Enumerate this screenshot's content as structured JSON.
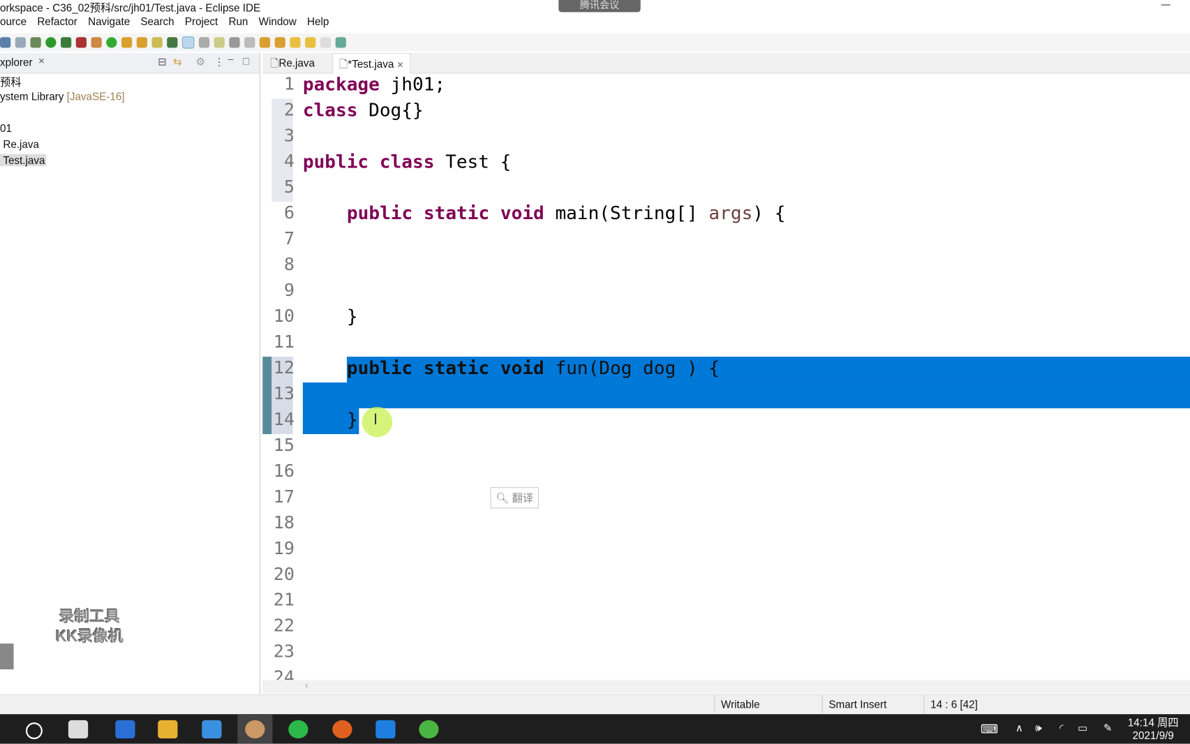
{
  "window": {
    "title": "orkspace - C36_02预科/src/jh01/Test.java - Eclipse IDE",
    "meeting_badge": "腾讯会议"
  },
  "menu": [
    "ource",
    "Refactor",
    "Navigate",
    "Search",
    "Project",
    "Run",
    "Window",
    "Help"
  ],
  "explorer": {
    "tab_label": "xplorer",
    "items": [
      "预科",
      "ystem Library",
      "[JavaSE-16]",
      "01",
      "Re.java",
      "Test.java"
    ]
  },
  "editor": {
    "tabs": [
      {
        "label": "Re.java"
      },
      {
        "label": "*Test.java",
        "active": true
      }
    ],
    "line_numbers": [
      "1",
      "2",
      "3",
      "4",
      "5",
      "6",
      "7",
      "8",
      "9",
      "10",
      "11",
      "12",
      "13",
      "14",
      "15",
      "16",
      "17",
      "18",
      "19",
      "20",
      "21",
      "22",
      "23",
      "24"
    ],
    "lines": {
      "l1a": "package",
      "l1b": " jh01;",
      "l2a": "class",
      "l2b": " Dog{}",
      "l4a": "public class",
      "l4b": " Test {",
      "l6a": "public static void",
      "l6b": " main(String[] ",
      "l6c": "args",
      "l6d": ") {",
      "l10": "}",
      "l12a": "public static void",
      "l12b": " fun(Dog dog ) {",
      "l14": "}"
    },
    "popup_label": "翻译"
  },
  "watermark": [
    "录制工具",
    "KK录像机"
  ],
  "status": {
    "writable": "Writable",
    "insert_mode": "Smart Insert",
    "position": "14 : 6 [42]"
  },
  "taskbar": {
    "time": "14:14 周四",
    "date": "2021/9/9"
  },
  "colors": {
    "selection": "#0078d7",
    "keyword": "#7f0055",
    "taskbar": "#1e1e1e"
  }
}
